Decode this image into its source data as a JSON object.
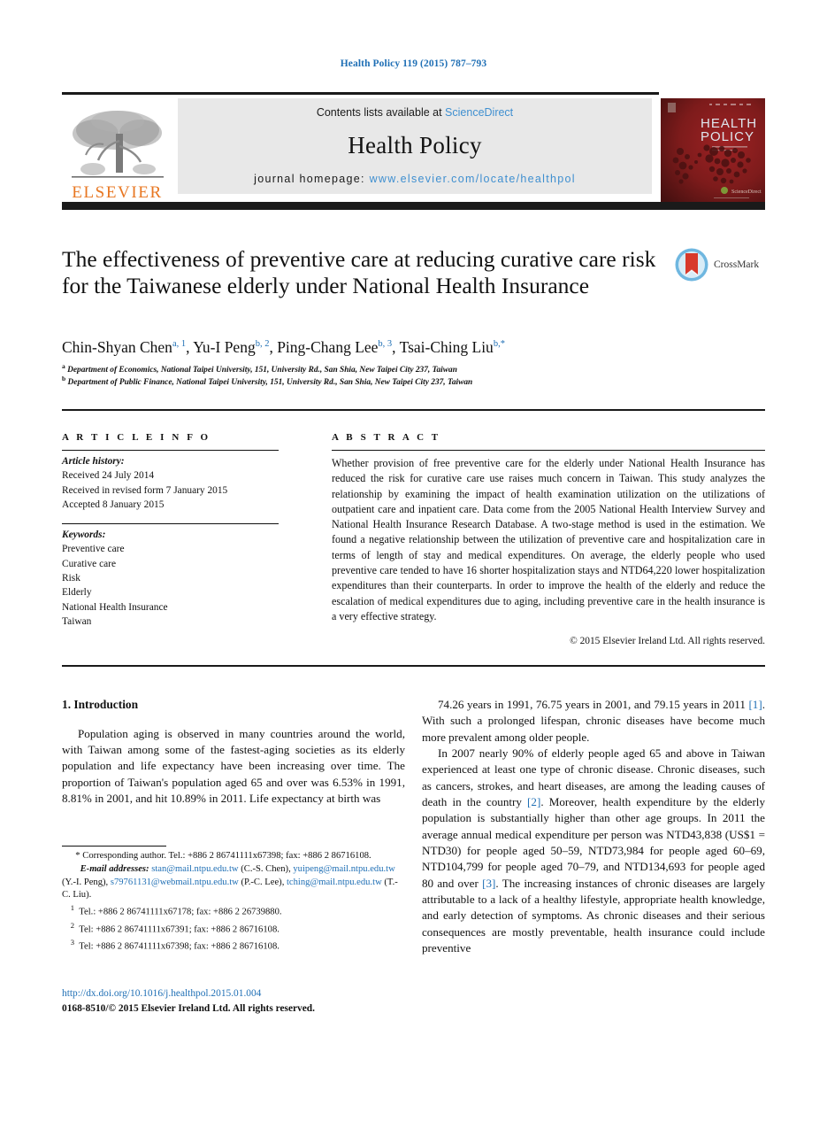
{
  "running_head": "Health Policy 119 (2015) 787–793",
  "masthead": {
    "contents_prefix": "Contents lists available at ",
    "contents_link": "ScienceDirect",
    "journal_name": "Health Policy",
    "homepage_prefix": "journal homepage: ",
    "homepage_url": "www.elsevier.com/locate/healthpol",
    "publisher": "ELSEVIER",
    "cover_title_line1": "HEALTH",
    "cover_title_line2": "POLICY"
  },
  "crossmark": {
    "label": "CrossMark"
  },
  "article": {
    "title": "The effectiveness of preventive care at reducing curative care risk for the Taiwanese elderly under National Health Insurance",
    "authors_html": "Chin-Shyan Chen<sup>a, 1</sup>, Yu-I Peng<sup>b, 2</sup>, Ping-Chang Lee<sup>b, 3</sup>, Tsai-Ching Liu<sup>b,</sup><sup>*</sup>",
    "affiliation_a": "Department of Economics, National Taipei University, 151, University Rd., San Shia, New Taipei City 237, Taiwan",
    "affiliation_b": "Department of Public Finance, National Taipei University, 151, University Rd., San Shia, New Taipei City 237, Taiwan"
  },
  "info": {
    "heading": "A R T I C L E   I N F O",
    "history_label": "Article history:",
    "history": [
      "Received 24 July 2014",
      "Received in revised form 7 January 2015",
      "Accepted 8 January 2015"
    ],
    "keywords_label": "Keywords:",
    "keywords": [
      "Preventive care",
      "Curative care",
      "Risk",
      "Elderly",
      "National Health Insurance",
      "Taiwan"
    ]
  },
  "abstract": {
    "heading": "A B S T R A C T",
    "text": "Whether provision of free preventive care for the elderly under National Health Insurance has reduced the risk for curative care use raises much concern in Taiwan. This study analyzes the relationship by examining the impact of health examination utilization on the utilizations of outpatient care and inpatient care. Data come from the 2005 National Health Interview Survey and National Health Insurance Research Database. A two-stage method is used in the estimation. We found a negative relationship between the utilization of preventive care and hospitalization care in terms of length of stay and medical expenditures. On average, the elderly people who used preventive care tended to have 16 shorter hospitalization stays and NTD64,220 lower hospitalization expenditures than their counterparts. In order to improve the health of the elderly and reduce the escalation of medical expenditures due to aging, including preventive care in the health insurance is a very effective strategy.",
    "copyright": "© 2015 Elsevier Ireland Ltd. All rights reserved."
  },
  "body": {
    "section_title": "1.  Introduction",
    "left_paragraphs": [
      "Population aging is observed in many countries around the world, with Taiwan among some of the fastest-aging societies as its elderly population and life expectancy have been increasing over time. The proportion of Taiwan's population aged 65 and over was 6.53% in 1991, 8.81% in 2001, and hit 10.89% in 2011. Life expectancy at birth was"
    ],
    "right_paragraphs": [
      "74.26 years in 1991, 76.75 years in 2001, and 79.15 years in 2011 [1]. With such a prolonged lifespan, chronic diseases have become much more prevalent among older people.",
      "In 2007 nearly 90% of elderly people aged 65 and above in Taiwan experienced at least one type of chronic disease. Chronic diseases, such as cancers, strokes, and heart diseases, are among the leading causes of death in the country [2]. Moreover, health expenditure by the elderly population is substantially higher than other age groups. In 2011 the average annual medical expenditure per person was NTD43,838 (US$1 = NTD30) for people aged 50–59, NTD73,984 for people aged 60–69, NTD104,799 for people aged 70–79, and NTD134,693 for people aged 80 and over [3]. The increasing instances of chronic diseases are largely attributable to a lack of a healthy lifestyle, appropriate health knowledge, and early detection of symptoms. As chronic diseases and their serious consequences are mostly preventable, health insurance could include preventive"
    ]
  },
  "footnotes": {
    "corresponding": "Corresponding author. Tel.: +886 2 86741111x67398; fax: +886 2 86716108.",
    "email_label": "E-mail addresses:",
    "emails": [
      {
        "address": "stan@mail.ntpu.edu.tw",
        "owner": "(C.-S. Chen)"
      },
      {
        "address": "yuipeng@mail.ntpu.edu.tw",
        "owner": "(Y.-I. Peng)"
      },
      {
        "address": "s79761131@webmail.ntpu.edu.tw",
        "owner": "(P.-C. Lee)"
      },
      {
        "address": "tching@mail.ntpu.edu.tw",
        "owner": "(T.-C. Liu)."
      }
    ],
    "numbered": [
      {
        "num": "1",
        "text": "Tel.: +886 2 86741111x67178; fax: +886 2 26739880."
      },
      {
        "num": "2",
        "text": "Tel: +886 2 86741111x67391; fax: +886 2 86716108."
      },
      {
        "num": "3",
        "text": "Tel: +886 2 86741111x67398; fax: +886 2 86716108."
      }
    ]
  },
  "bottom": {
    "doi": "http://dx.doi.org/10.1016/j.healthpol.2015.01.004",
    "issn": "0168-8510/© 2015 Elsevier Ireland Ltd. All rights reserved."
  }
}
